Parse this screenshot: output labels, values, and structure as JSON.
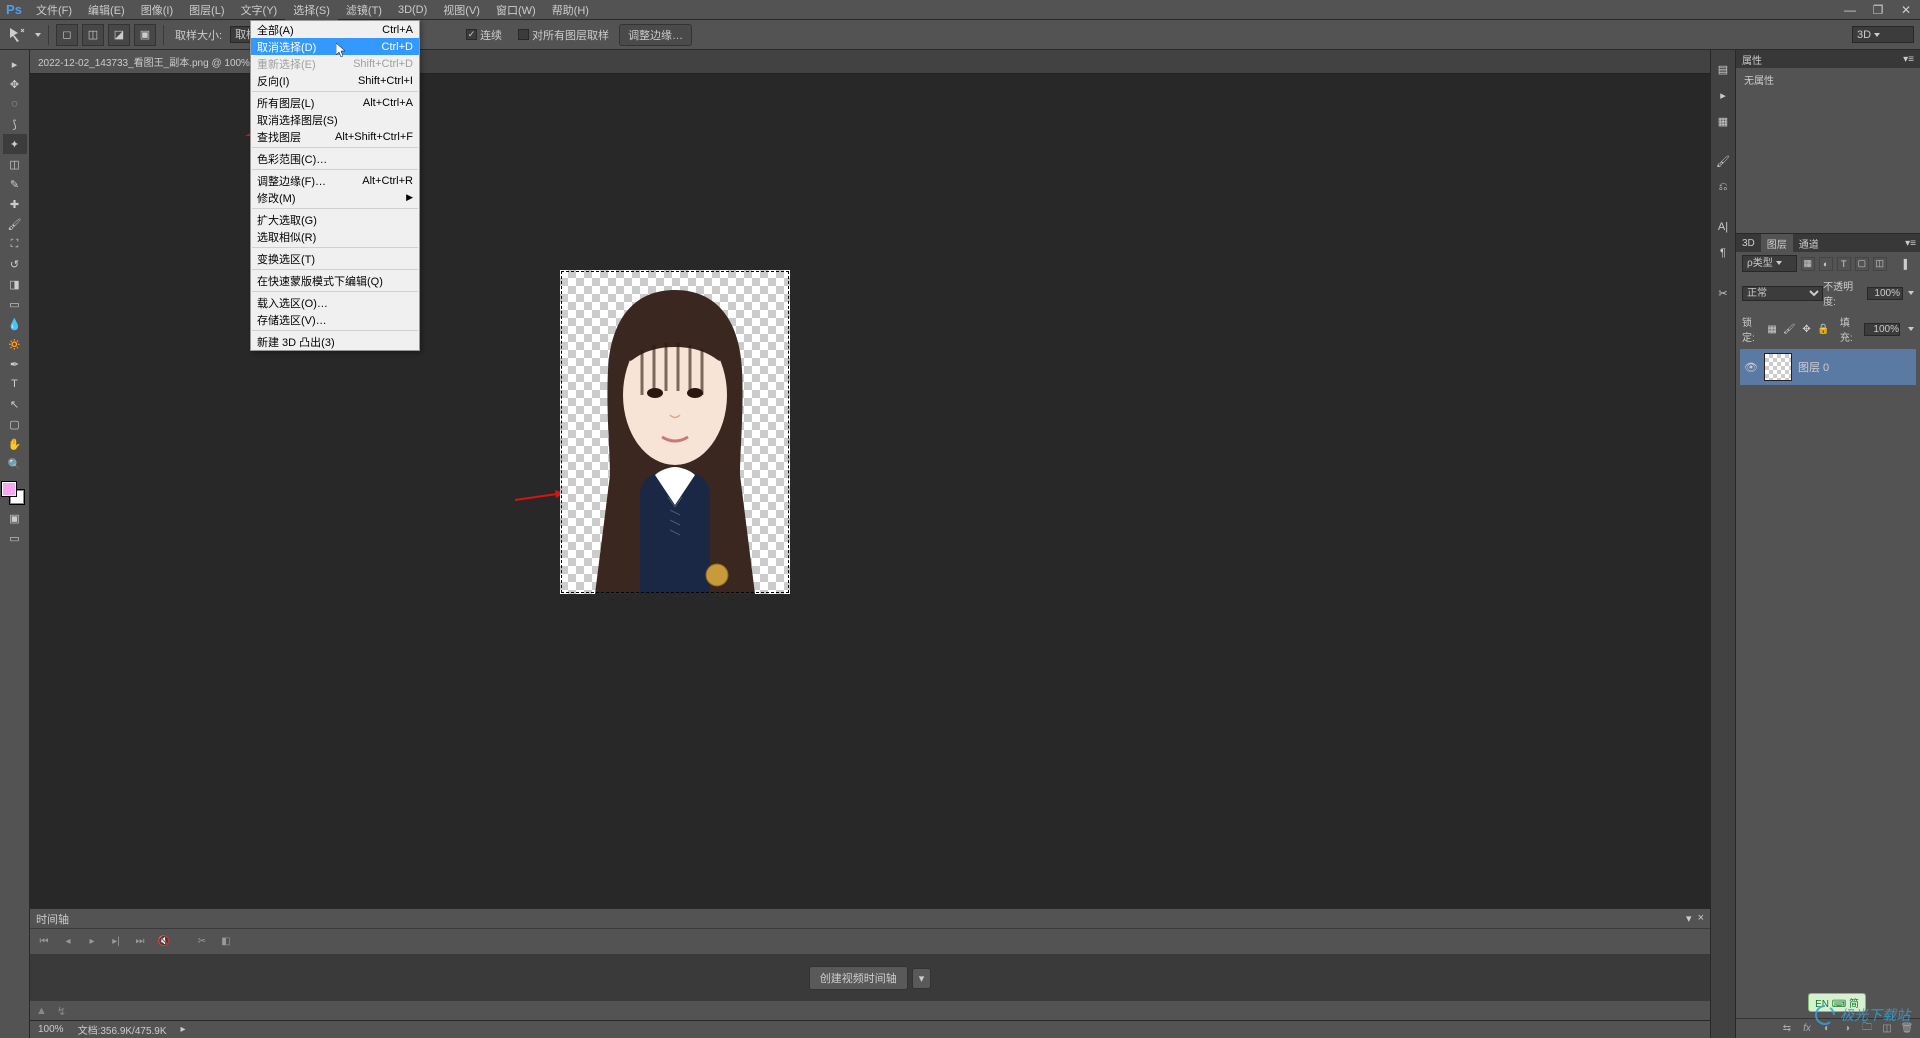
{
  "app": {
    "logo": "Ps"
  },
  "menubar": [
    "文件(F)",
    "编辑(E)",
    "图像(I)",
    "图层(L)",
    "文字(Y)",
    "选择(S)",
    "滤镜(T)",
    "3D(D)",
    "视图(V)",
    "窗口(W)",
    "帮助(H)"
  ],
  "menubar_active_index": 5,
  "window_controls": {
    "min": "—",
    "max": "❐",
    "close": "✕"
  },
  "options": {
    "sample_size_label": "取样大小:",
    "sample_size_value": "取样点",
    "continuous_label": "连续",
    "continuous_checked": true,
    "all_layers_label": "对所有图层取样",
    "all_layers_checked": false,
    "refine_edge_btn": "调整边缘…",
    "render_mode": "3D"
  },
  "dropdown": {
    "items": [
      {
        "label": "全部(A)",
        "shortcut": "Ctrl+A"
      },
      {
        "label": "取消选择(D)",
        "shortcut": "Ctrl+D",
        "highlighted": true
      },
      {
        "label": "重新选择(E)",
        "shortcut": "Shift+Ctrl+D",
        "disabled": true
      },
      {
        "label": "反向(I)",
        "shortcut": "Shift+Ctrl+I"
      },
      {
        "sep": true
      },
      {
        "label": "所有图层(L)",
        "shortcut": "Alt+Ctrl+A"
      },
      {
        "label": "取消选择图层(S)"
      },
      {
        "label": "查找图层",
        "shortcut": "Alt+Shift+Ctrl+F"
      },
      {
        "sep": true
      },
      {
        "label": "色彩范围(C)…"
      },
      {
        "sep": true
      },
      {
        "label": "调整边缘(F)…",
        "shortcut": "Alt+Ctrl+R"
      },
      {
        "label": "修改(M)",
        "submenu": true
      },
      {
        "sep": true
      },
      {
        "label": "扩大选取(G)"
      },
      {
        "label": "选取相似(R)"
      },
      {
        "sep": true
      },
      {
        "label": "变换选区(T)"
      },
      {
        "sep": true
      },
      {
        "label": "在快速蒙版模式下编辑(Q)"
      },
      {
        "sep": true
      },
      {
        "label": "载入选区(O)…"
      },
      {
        "label": "存储选区(V)…"
      },
      {
        "sep": true
      },
      {
        "label": "新建 3D 凸出(3)"
      }
    ]
  },
  "document": {
    "tab_title": "2022-12-02_143733_看图王_副本.png @ 100% (图…"
  },
  "timeline": {
    "title": "时间轴",
    "create_btn": "创建视频时间轴",
    "footer_zoom": "▲▲"
  },
  "statusbar": {
    "zoom": "100%",
    "doc_info": "文档:356.9K/475.9K"
  },
  "panels": {
    "properties_title": "属性",
    "properties_body": "无属性",
    "layers_tabs": [
      "3D",
      "图层",
      "通道"
    ],
    "layers_active_tab": 1,
    "filter_label": "ρ类型",
    "blend_mode": "正常",
    "opacity_label": "不透明度:",
    "opacity_value": "100%",
    "lock_label": "锁定:",
    "fill_label": "填充:",
    "fill_value": "100%",
    "layer0_name": "图层 0"
  },
  "ime": {
    "text": "EN ⌨ 简"
  },
  "watermark": "极光下载站"
}
